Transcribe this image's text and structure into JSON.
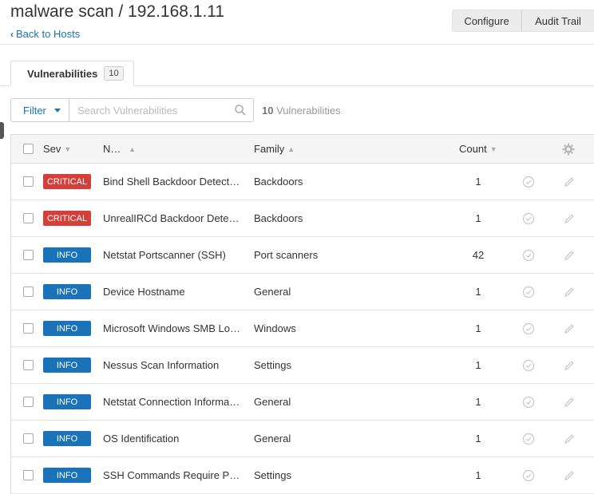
{
  "header": {
    "title": "malware scan / 192.168.1.11",
    "back_label": "Back to Hosts",
    "buttons": {
      "configure": "Configure",
      "audit_trail": "Audit Trail"
    }
  },
  "tabs": [
    {
      "label": "Vulnerabilities",
      "count": "10"
    }
  ],
  "toolbar": {
    "filter_label": "Filter",
    "search_placeholder": "Search Vulnerabilities",
    "count_number": "10",
    "count_label": "Vulnerabilities"
  },
  "table": {
    "columns": {
      "sev": "Sev",
      "name": "Name",
      "family": "Family",
      "count": "Count"
    },
    "rows": [
      {
        "sev": "CRITICAL",
        "name": "Bind Shell Backdoor Detection",
        "family": "Backdoors",
        "count": "1"
      },
      {
        "sev": "CRITICAL",
        "name": "UnrealIRCd Backdoor Detection",
        "family": "Backdoors",
        "count": "1"
      },
      {
        "sev": "INFO",
        "name": "Netstat Portscanner (SSH)",
        "family": "Port scanners",
        "count": "42"
      },
      {
        "sev": "INFO",
        "name": "Device Hostname",
        "family": "General",
        "count": "1"
      },
      {
        "sev": "INFO",
        "name": "Microsoft Windows SMB Log In Possible",
        "family": "Windows",
        "count": "1"
      },
      {
        "sev": "INFO",
        "name": "Nessus Scan Information",
        "family": "Settings",
        "count": "1"
      },
      {
        "sev": "INFO",
        "name": "Netstat Connection Information",
        "family": "General",
        "count": "1"
      },
      {
        "sev": "INFO",
        "name": "OS Identification",
        "family": "General",
        "count": "1"
      },
      {
        "sev": "INFO",
        "name": "SSH Commands Require Privilege Escalation",
        "family": "Settings",
        "count": "1"
      }
    ]
  },
  "colors": {
    "critical": "#d43f3a",
    "info": "#1a73b8",
    "link": "#1a73b8"
  },
  "icons": [
    "chevron-left-icon",
    "caret-down-icon",
    "search-icon",
    "gear-icon",
    "check-circle-icon",
    "pencil-icon"
  ]
}
